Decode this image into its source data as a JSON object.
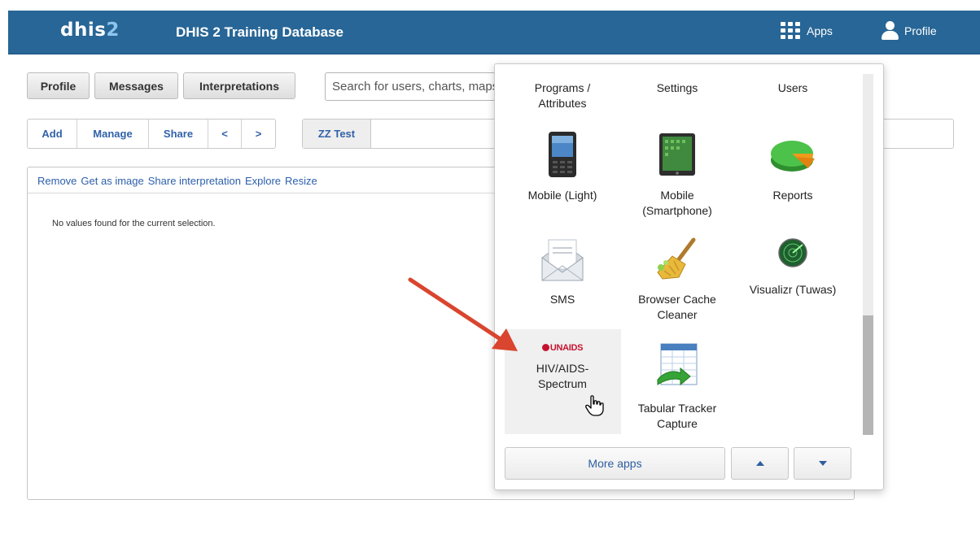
{
  "header": {
    "logo_text": "dhis",
    "logo_num": "2",
    "title": "DHIS 2 Training Database",
    "apps_label": "Apps",
    "profile_label": "Profile"
  },
  "top_buttons": {
    "profile": "Profile",
    "messages": "Messages",
    "interpretations": "Interpretations"
  },
  "search": {
    "value": "Search for users, charts, maps"
  },
  "toolbar": {
    "add": "Add",
    "manage": "Manage",
    "share": "Share",
    "prev": "<",
    "next": ">"
  },
  "dashboards": {
    "active_tab": "ZZ Test"
  },
  "item": {
    "actions": [
      "Remove",
      "Get as image",
      "Share interpretation",
      "Explore",
      "Resize"
    ],
    "message": "No values found for the current selection."
  },
  "apps_menu": {
    "apps": [
      {
        "label": "Programs / Attributes",
        "icon": "programs-icon"
      },
      {
        "label": "Settings",
        "icon": "settings-icon"
      },
      {
        "label": "Users",
        "icon": "users-icon"
      },
      {
        "label": "Mobile (Light)",
        "icon": "mobile-phone-icon"
      },
      {
        "label": "Mobile (Smartphone)",
        "icon": "tablet-icon"
      },
      {
        "label": "Reports",
        "icon": "pie-chart-icon"
      },
      {
        "label": "SMS",
        "icon": "envelope-icon"
      },
      {
        "label": "Browser Cache Cleaner",
        "icon": "broom-icon"
      },
      {
        "label": "Visualizr (Tuwas)",
        "icon": "radar-icon"
      },
      {
        "label": "HIV/AIDS-Spectrum",
        "icon": "unaids-logo-icon",
        "logo_text": "UNAIDS"
      },
      {
        "label": "Tabular Tracker Capture",
        "icon": "spreadsheet-icon"
      }
    ],
    "more_apps": "More apps"
  },
  "colors": {
    "header_bg": "#276696",
    "link_blue": "#3162a8",
    "arrow_red": "#d9452e"
  }
}
